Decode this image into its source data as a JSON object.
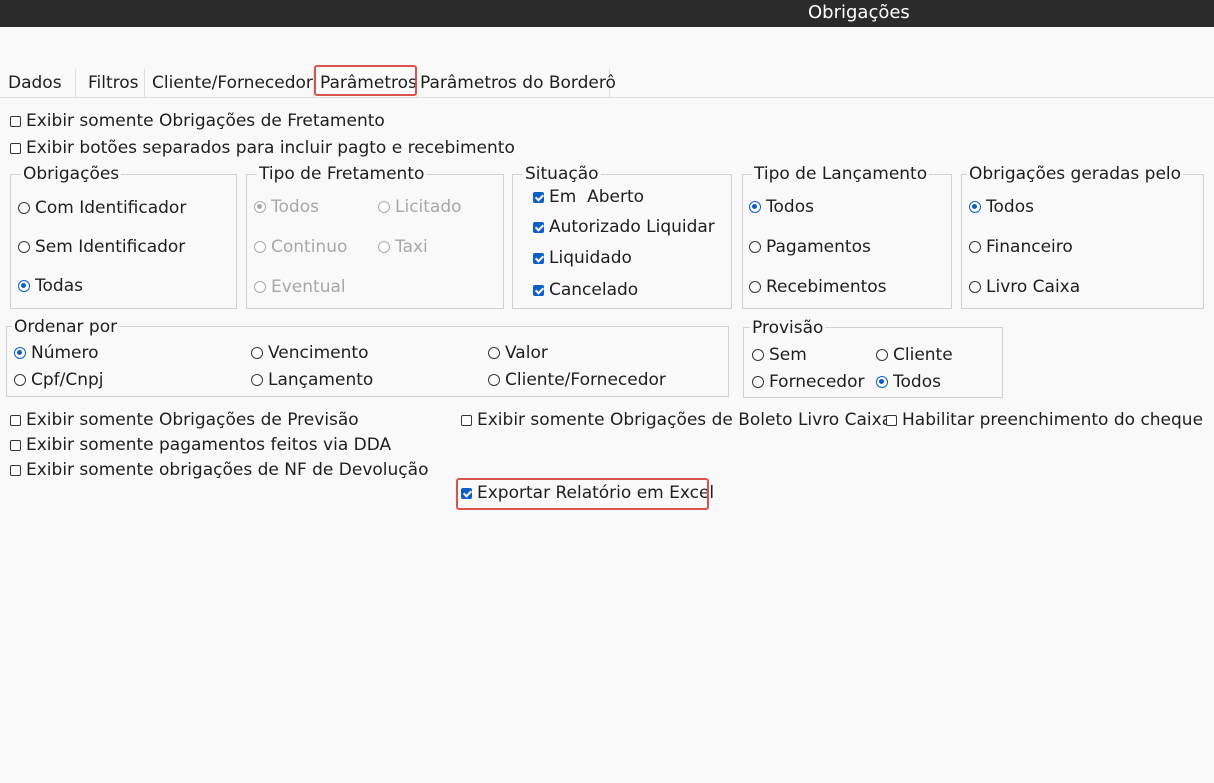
{
  "window": {
    "title": "Obrigações"
  },
  "tabs": [
    "Dados",
    "Filtros",
    "Cliente/Fornecedor",
    "Parâmetros",
    "Parâmetros do Borderô"
  ],
  "active_tab": "Parâmetros",
  "top_options": {
    "fretamento": {
      "label": "Exibir somente Obrigações de Fretamento",
      "checked": false
    },
    "botoes_separados": {
      "label": "Exibir botões separados para incluir pagto e recebimento",
      "checked": false
    }
  },
  "obrigacoes": {
    "legend": "Obrigações",
    "options": [
      "Com Identificador",
      "Sem Identificador",
      "Todas"
    ],
    "selected": "Todas"
  },
  "tipo_fretamento": {
    "legend": "Tipo de Fretamento",
    "options": [
      "Todos",
      "Licitado",
      "Continuo",
      "Taxi",
      "Eventual"
    ],
    "selected": "Todos",
    "disabled": true
  },
  "situacao": {
    "legend": "Situação",
    "options": [
      {
        "label": "Em  Aberto",
        "checked": true
      },
      {
        "label": "Autorizado Liquidar",
        "checked": true
      },
      {
        "label": "Liquidado",
        "checked": true
      },
      {
        "label": "Cancelado",
        "checked": true
      }
    ]
  },
  "tipo_lancamento": {
    "legend": "Tipo de Lançamento",
    "options": [
      "Todos",
      "Pagamentos",
      "Recebimentos"
    ],
    "selected": "Todos"
  },
  "geradas_pelo": {
    "legend": "Obrigações geradas pelo",
    "options": [
      "Todos",
      "Financeiro",
      "Livro Caixa"
    ],
    "selected": "Todos"
  },
  "ordenar": {
    "legend": "Ordenar por",
    "options": [
      "Número",
      "Vencimento",
      "Valor",
      "Cpf/Cnpj",
      "Lançamento",
      "Cliente/Fornecedor"
    ],
    "selected": "Número"
  },
  "provisao": {
    "legend": "Provisão",
    "options": [
      "Sem",
      "Cliente",
      "Fornecedor",
      "Todos"
    ],
    "selected": "Todos"
  },
  "bottom_options": {
    "previsao": {
      "label": "Exibir somente Obrigações de Previsão",
      "checked": false
    },
    "dda": {
      "label": "Exibir somente pagamentos feitos via DDA",
      "checked": false
    },
    "nf_devolucao": {
      "label": "Exibir somente obrigações de NF de Devolução",
      "checked": false
    },
    "boleto_livro_caixa": {
      "label": "Exibir somente Obrigações de Boleto Livro Caixa",
      "checked": false
    },
    "cheque": {
      "label": "Habilitar preenchimento do cheque",
      "checked": false
    },
    "excel": {
      "label": "Exportar Relatório em Excel",
      "checked": true
    }
  },
  "colors": {
    "accent": "#0d5ec5",
    "highlight": "#d9534f",
    "titlebar": "#2b2b2b"
  }
}
